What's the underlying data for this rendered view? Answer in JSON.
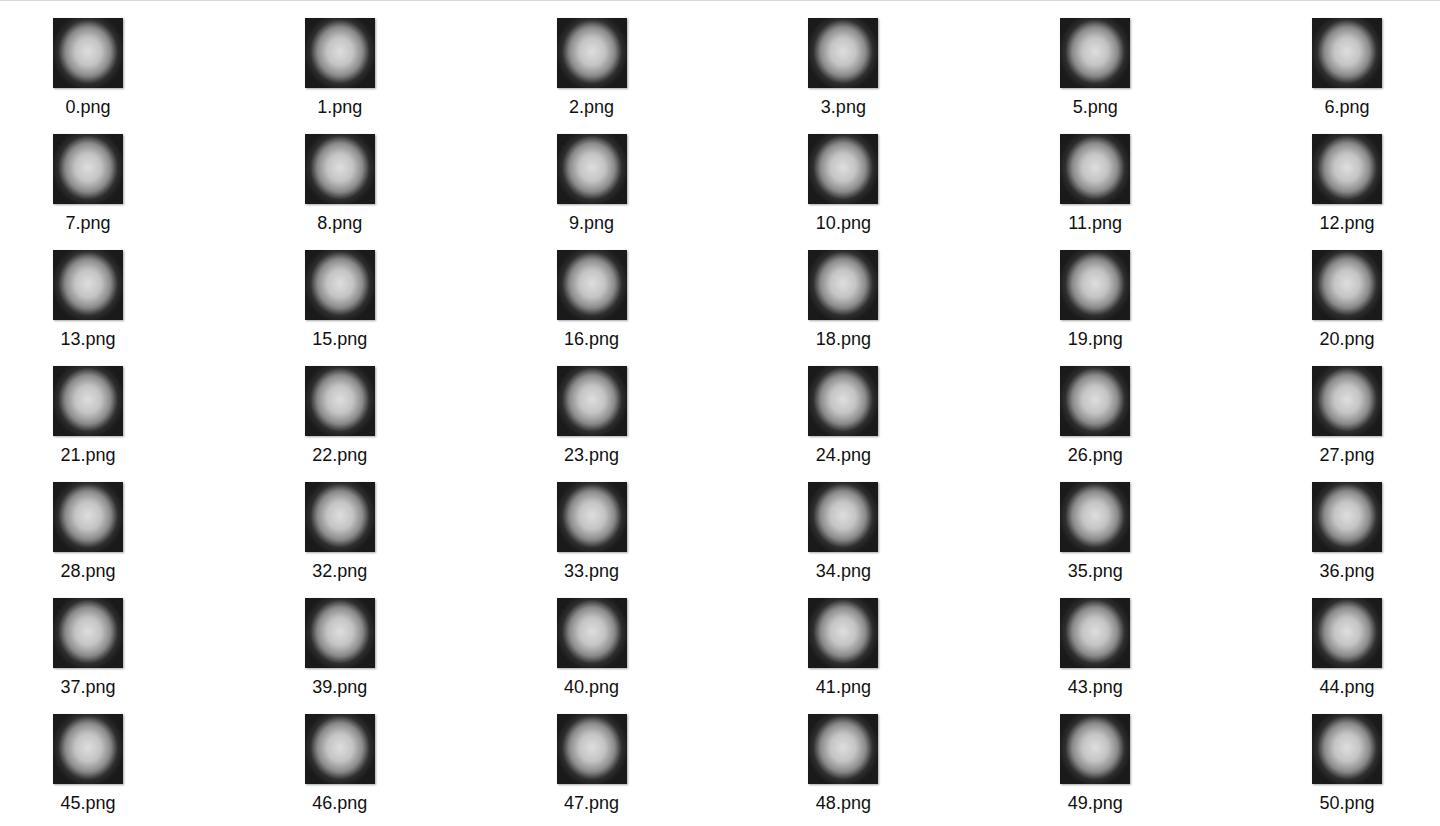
{
  "files": [
    {
      "name": "0.png",
      "selected": false
    },
    {
      "name": "1.png",
      "selected": false
    },
    {
      "name": "2.png",
      "selected": false
    },
    {
      "name": "3.png",
      "selected": false
    },
    {
      "name": "5.png",
      "selected": false
    },
    {
      "name": "6.png",
      "selected": false
    },
    {
      "name": "7.png",
      "selected": false
    },
    {
      "name": "8.png",
      "selected": false
    },
    {
      "name": "9.png",
      "selected": false
    },
    {
      "name": "10.png",
      "selected": false
    },
    {
      "name": "11.png",
      "selected": false
    },
    {
      "name": "12.png",
      "selected": false
    },
    {
      "name": "13.png",
      "selected": false
    },
    {
      "name": "15.png",
      "selected": false
    },
    {
      "name": "16.png",
      "selected": false
    },
    {
      "name": "18.png",
      "selected": false
    },
    {
      "name": "19.png",
      "selected": false
    },
    {
      "name": "20.png",
      "selected": false
    },
    {
      "name": "21.png",
      "selected": false
    },
    {
      "name": "22.png",
      "selected": false
    },
    {
      "name": "23.png",
      "selected": false
    },
    {
      "name": "24.png",
      "selected": false
    },
    {
      "name": "26.png",
      "selected": false
    },
    {
      "name": "27.png",
      "selected": false
    },
    {
      "name": "28.png",
      "selected": false
    },
    {
      "name": "32.png",
      "selected": false
    },
    {
      "name": "33.png",
      "selected": false
    },
    {
      "name": "34.png",
      "selected": false
    },
    {
      "name": "35.png",
      "selected": false
    },
    {
      "name": "36.png",
      "selected": false
    },
    {
      "name": "37.png",
      "selected": false
    },
    {
      "name": "39.png",
      "selected": false
    },
    {
      "name": "40.png",
      "selected": false
    },
    {
      "name": "41.png",
      "selected": false
    },
    {
      "name": "43.png",
      "selected": false
    },
    {
      "name": "44.png",
      "selected": false
    },
    {
      "name": "45.png",
      "selected": false
    },
    {
      "name": "46.png",
      "selected": false
    },
    {
      "name": "47.png",
      "selected": false
    },
    {
      "name": "48.png",
      "selected": false
    },
    {
      "name": "49.png",
      "selected": false
    },
    {
      "name": "50.png",
      "selected": false
    }
  ]
}
